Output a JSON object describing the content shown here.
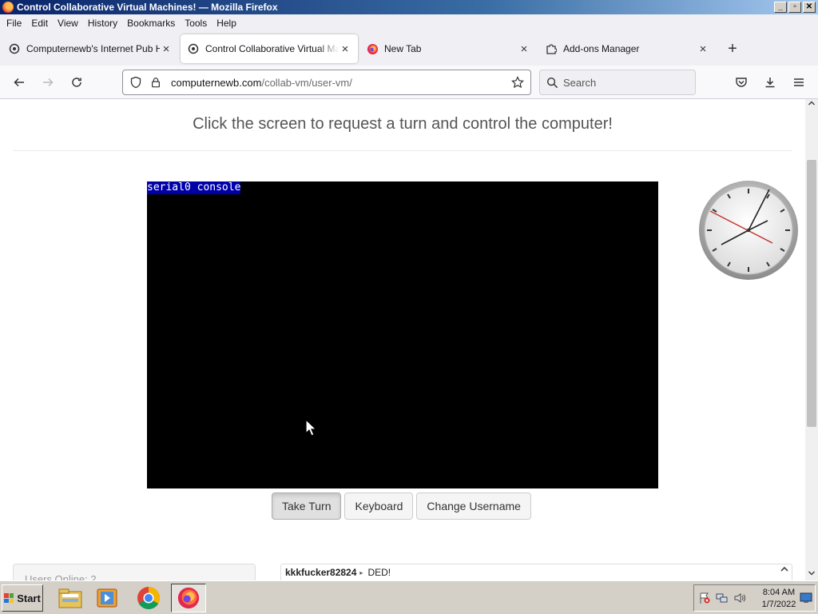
{
  "window": {
    "title": "Control Collaborative Virtual Machines! — Mozilla Firefox"
  },
  "window_controls": {
    "minimize": "_",
    "maximize": "▫",
    "close": "✕"
  },
  "menu": [
    {
      "label": "File"
    },
    {
      "label": "Edit"
    },
    {
      "label": "View"
    },
    {
      "label": "History"
    },
    {
      "label": "Bookmarks"
    },
    {
      "label": "Tools"
    },
    {
      "label": "Help"
    }
  ],
  "tabs": [
    {
      "label": "Computernewb's Internet Pub Hub",
      "icon": "puzzle-site-icon",
      "active": false
    },
    {
      "label": "Control Collaborative Virtual Machines!",
      "icon": "puzzle-site-icon",
      "active": true
    },
    {
      "label": "New Tab",
      "icon": "firefox-icon",
      "active": false
    },
    {
      "label": "Add-ons Manager",
      "icon": "puzzle-piece-icon",
      "active": false
    }
  ],
  "new_tab_glyph": "+",
  "tab_close_glyph": "×",
  "nav": {
    "url_domain": "computernewb.com",
    "url_path": "/collab-vm/user-vm/",
    "search_placeholder": "Search"
  },
  "page": {
    "heading": "Click the screen to request a turn and control the computer!",
    "vm_console_label": "serial0 console",
    "buttons": {
      "take_turn": "Take Turn",
      "keyboard": "Keyboard",
      "change_username": "Change Username"
    },
    "users_online": "Users Online: 2",
    "chat": [
      {
        "user": "kkkfucker82824",
        "text": "DED!"
      }
    ]
  },
  "taskbar": {
    "start_label": "Start",
    "time": "8:04 AM",
    "date": "1/7/2022"
  },
  "colors": {
    "vm_label_bg": "#0000a8",
    "accent_firefox": "#ff7139"
  }
}
